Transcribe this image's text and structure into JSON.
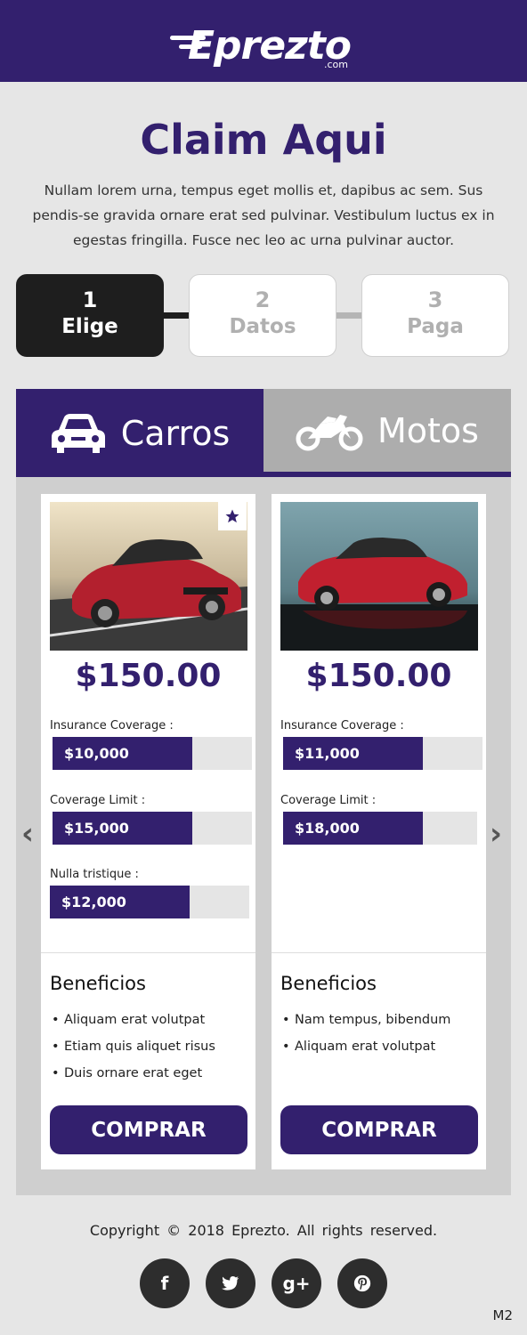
{
  "header": {
    "logo_text": "Eprezto",
    "logo_suffix": ".com"
  },
  "page_title": "Claim Aqui",
  "intro": "Nullam lorem urna, tempus eget mollis et, dapibus ac sem. Sus pendis-se gravida ornare erat sed pulvinar. Vestibulum luctus ex in egestas fringilla. Fusce nec leo ac urna pulvinar auctor.",
  "steps": [
    {
      "num": "1",
      "label": "Elige",
      "state": "active"
    },
    {
      "num": "2",
      "label": "Datos",
      "state": "inactive"
    },
    {
      "num": "3",
      "label": "Paga",
      "state": "inactive"
    }
  ],
  "tabs": [
    {
      "label": "Carros",
      "icon": "car-icon",
      "active": true
    },
    {
      "label": "Motos",
      "icon": "motorcycle-icon",
      "active": false
    }
  ],
  "cards": [
    {
      "price": "$150.00",
      "image": "red-sedan-road-photo",
      "favorite": true,
      "attributes": [
        {
          "label": "Insurance Coverage :",
          "value": "$10,000",
          "level": 0.7
        },
        {
          "label": "Coverage Limit :",
          "value": "$15,000",
          "level": 0.7
        },
        {
          "label": "Nulla tristique :",
          "value": "$12,000",
          "level": 0.7
        }
      ],
      "benefits_title": "Beneficios",
      "benefits": [
        "Aliquam erat volutpat",
        "Etiam quis aliquet risus",
        "Duis ornare erat eget"
      ],
      "button": "COMPRAR"
    },
    {
      "price": "$150.00",
      "image": "red-sedan-studio-photo",
      "favorite": false,
      "attributes": [
        {
          "label": "Insurance Coverage :",
          "value": "$11,000",
          "level": 0.7
        },
        {
          "label": "Coverage Limit :",
          "value": "$18,000",
          "level": 0.7
        }
      ],
      "benefits_title": "Beneficios",
      "benefits": [
        "Nam tempus, bibendum",
        "Aliquam erat volutpat"
      ],
      "button": "COMPRAR"
    }
  ],
  "carousel": {
    "prev_icon": "chevron-left-icon",
    "next_icon": "chevron-right-icon"
  },
  "footer": {
    "copyright": "Copyright  ©  2018  Eprezto.   All rights reserved.",
    "socials": [
      {
        "name": "facebook",
        "glyph": "f"
      },
      {
        "name": "twitter",
        "glyph": "t"
      },
      {
        "name": "google-plus",
        "glyph": "g+"
      },
      {
        "name": "pinterest",
        "glyph": "p"
      }
    ]
  },
  "corner_tag": "M2",
  "colors": {
    "brand": "#33206e",
    "active_step": "#1e1e1e",
    "inactive_tab": "#adadad"
  }
}
